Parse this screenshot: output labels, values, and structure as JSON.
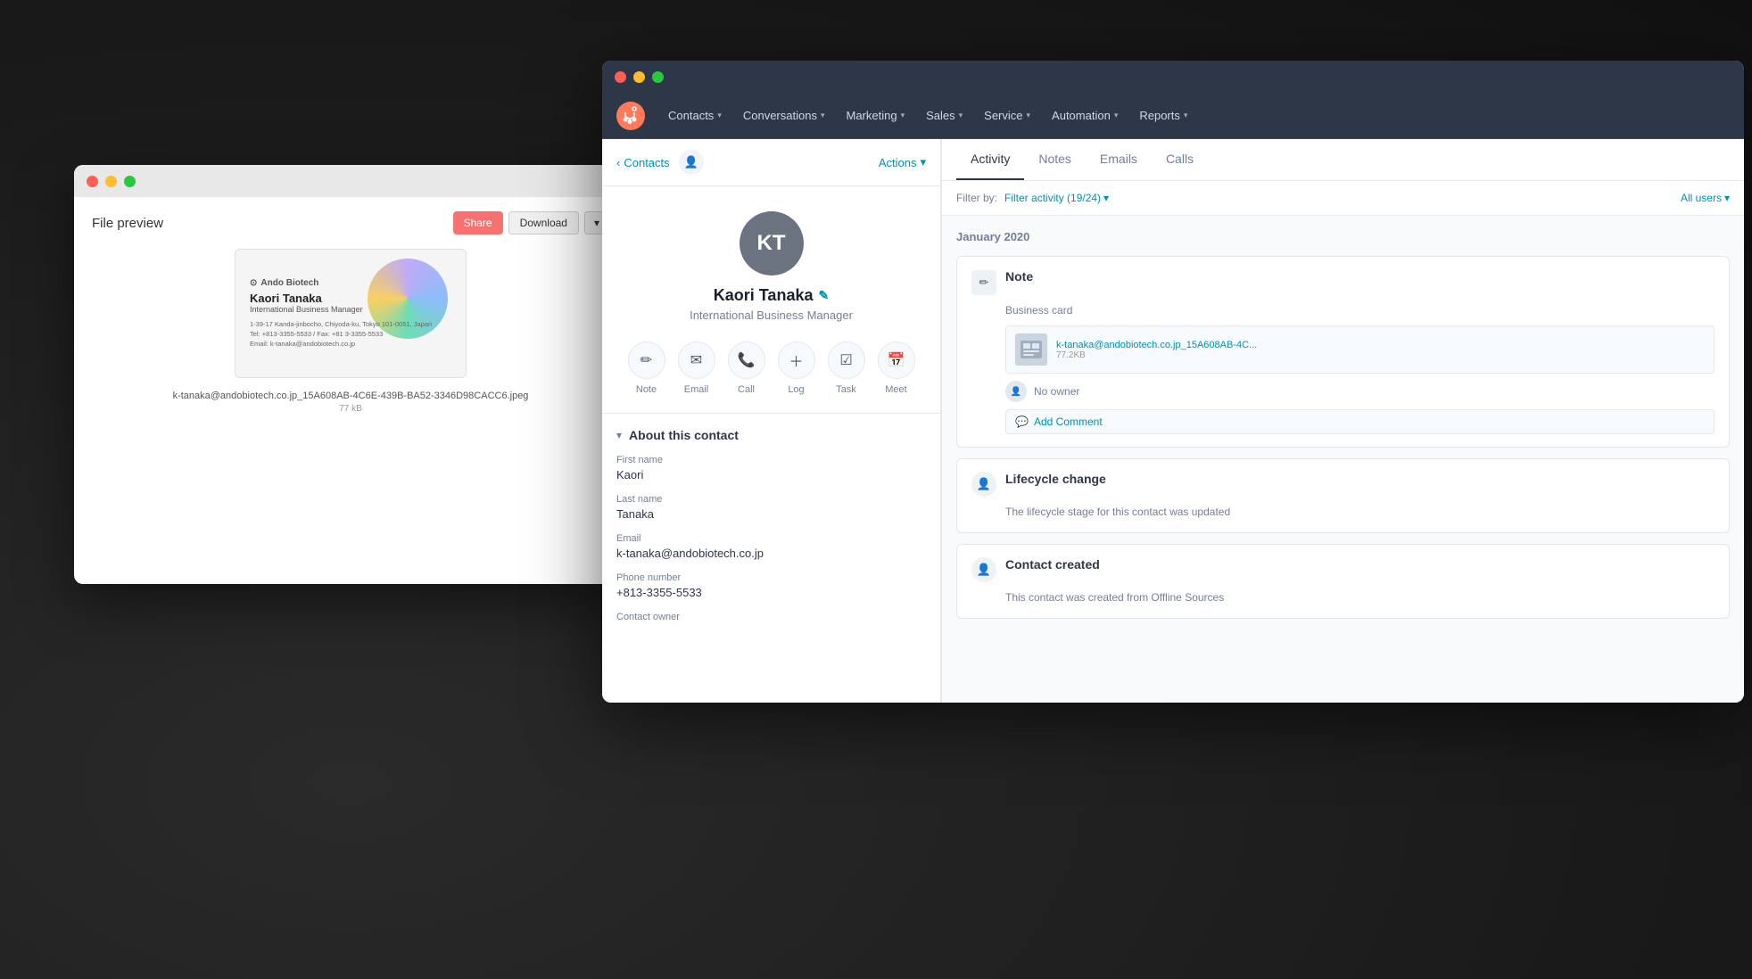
{
  "background": {
    "color": "#1a1a1a"
  },
  "file_preview_window": {
    "title": "File preview",
    "buttons": {
      "share": "Share",
      "download": "Download",
      "more": "▾"
    },
    "business_card": {
      "company": "Ando Biotech",
      "name": "Kaori Tanaka",
      "title": "International Business Manager",
      "address": "1-39-17 Kanda-jinbocho, Chiyoda-ku, Tokyo 101-0051, Japan",
      "tel": "Tel: +813-3355-5533 / Fax: +81 3-3355-5533",
      "email": "Email: k-tanaka@andobiotech.co.jp"
    },
    "filename": "k-tanaka@andobiotech.co.jp_15A608AB-4C6E-439B-BA52-3346D98CACC6.jpeg",
    "filesize": "77 kB"
  },
  "hubspot_window": {
    "nav": {
      "logo_alt": "HubSpot",
      "items": [
        {
          "label": "Contacts",
          "has_dropdown": true
        },
        {
          "label": "Conversations",
          "has_dropdown": true
        },
        {
          "label": "Marketing",
          "has_dropdown": true
        },
        {
          "label": "Sales",
          "has_dropdown": true
        },
        {
          "label": "Service",
          "has_dropdown": true
        },
        {
          "label": "Automation",
          "has_dropdown": true
        },
        {
          "label": "Reports",
          "has_dropdown": true
        }
      ]
    },
    "contact_header": {
      "back_label": "Contacts",
      "actions_label": "Actions"
    },
    "contact_profile": {
      "initials": "KT",
      "name": "Kaori Tanaka",
      "job_title": "International Business Manager",
      "action_buttons": [
        {
          "icon": "✏️",
          "label": "Note"
        },
        {
          "icon": "✉️",
          "label": "Email"
        },
        {
          "icon": "📞",
          "label": "Call"
        },
        {
          "icon": "➕",
          "label": "Log"
        },
        {
          "icon": "☑️",
          "label": "Task"
        },
        {
          "icon": "📅",
          "label": "Meet"
        }
      ]
    },
    "about_section": {
      "title": "About this contact",
      "fields": [
        {
          "label": "First name",
          "value": "Kaori"
        },
        {
          "label": "Last name",
          "value": "Tanaka"
        },
        {
          "label": "Email",
          "value": "k-tanaka@andobiotech.co.jp"
        },
        {
          "label": "Phone number",
          "value": "+813-3355-5533"
        },
        {
          "label": "Contact owner",
          "value": ""
        }
      ]
    },
    "activity_panel": {
      "tabs": [
        {
          "label": "Activity",
          "active": true
        },
        {
          "label": "Notes",
          "active": false
        },
        {
          "label": "Emails",
          "active": false
        },
        {
          "label": "Calls",
          "active": false
        }
      ],
      "filter_label": "Filter by:",
      "filter_activity": "Filter activity (19/24)",
      "filter_users": "All users",
      "month": "January 2020",
      "activities": [
        {
          "type": "note",
          "icon": "✏",
          "title": "Note",
          "body": "Business card",
          "attachment_name": "k-tanaka@andobiotech.co.jp_15A608AB-4C...",
          "attachment_size": "77.2KB",
          "owner": "No owner",
          "add_comment": "Add Comment"
        },
        {
          "type": "lifecycle",
          "icon": "👤",
          "title": "Lifecycle change",
          "body": "The lifecycle stage for this contact was updated"
        },
        {
          "type": "contact_created",
          "icon": "👤",
          "title": "Contact created",
          "body": "This contact was created from Offline Sources"
        }
      ]
    }
  }
}
